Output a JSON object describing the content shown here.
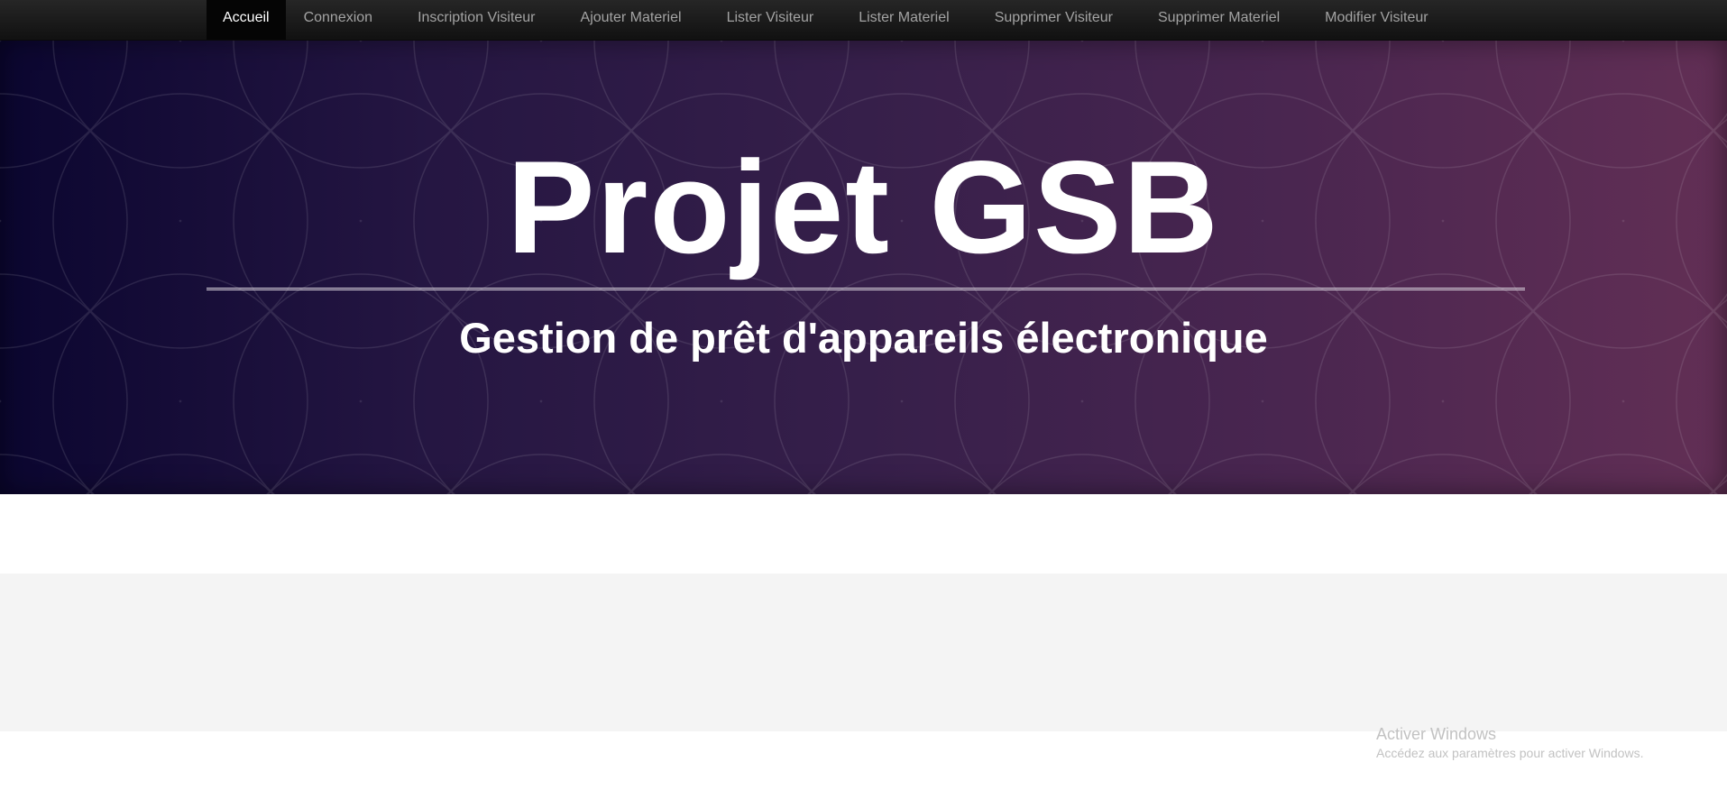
{
  "nav": {
    "items": [
      {
        "label": "Accueil",
        "active": true
      },
      {
        "label": "Connexion"
      },
      {
        "label": "Inscription Visiteur"
      },
      {
        "label": "Ajouter Materiel"
      },
      {
        "label": "Lister Visiteur"
      },
      {
        "label": "Lister Materiel"
      },
      {
        "label": "Supprimer Visiteur"
      },
      {
        "label": "Supprimer Materiel"
      },
      {
        "label": "Modifier Visiteur"
      }
    ]
  },
  "hero": {
    "title": "Projet GSB",
    "subtitle": "Gestion de prêt d'appareils électronique",
    "gradient_colors": [
      "#0b0630",
      "#361f4a",
      "#622f55"
    ]
  },
  "watermark": {
    "title": "Activer Windows",
    "subtitle": "Accédez aux paramètres pour activer Windows."
  },
  "colors": {
    "nav_bg": "#1a1a1a",
    "nav_text": "#a3a3a3",
    "nav_active_text": "#ffffff",
    "footer_bg": "#f4f4f4"
  }
}
